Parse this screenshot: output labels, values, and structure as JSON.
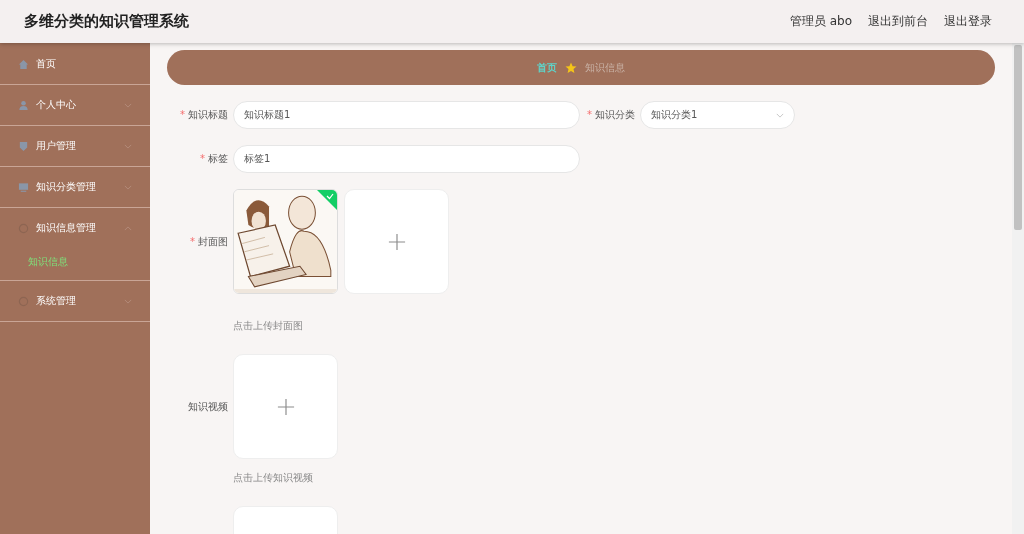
{
  "header": {
    "title": "多维分类的知识管理系统",
    "links": [
      "管理员 abo",
      "退出到前台",
      "退出登录"
    ]
  },
  "sidebar": {
    "items": [
      {
        "label": "首页"
      },
      {
        "label": "个人中心",
        "expanded": false
      },
      {
        "label": "用户管理",
        "expanded": false
      },
      {
        "label": "知识分类管理",
        "expanded": false
      },
      {
        "label": "知识信息管理",
        "expanded": true,
        "children": [
          {
            "label": "知识信息",
            "selected": true
          }
        ]
      },
      {
        "label": "系统管理",
        "expanded": false
      }
    ]
  },
  "breadcrumb": [
    {
      "label": "首页",
      "current": false
    },
    {
      "label": "知识信息",
      "current": true
    }
  ],
  "form": {
    "row_1": [
      {
        "kind": "input",
        "label": "知识标题",
        "required_mark": "*",
        "value": "知识标题1"
      },
      {
        "kind": "select",
        "label": "知识分类",
        "required_mark": "*",
        "value": "知识分类1"
      }
    ],
    "row_2": [
      {
        "kind": "input",
        "label": "标签",
        "required_mark": "*",
        "value": "标签1"
      }
    ],
    "uploads": [
      {
        "kind": "upload",
        "label": "封面图",
        "required_mark": "*",
        "files": [
          {
            "kind": "picture",
            "success": true
          }
        ],
        "hint": "点击上传封面图"
      },
      {
        "kind": "upload",
        "label": "知识视频",
        "hint": "点击上传知识视频"
      },
      {
        "kind": "upload"
      }
    ]
  }
}
